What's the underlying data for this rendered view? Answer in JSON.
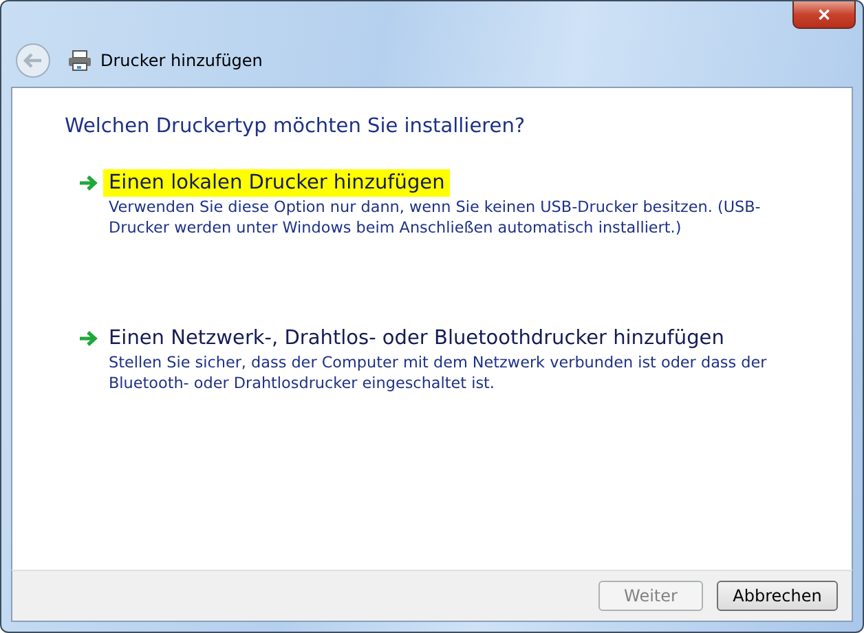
{
  "window": {
    "title": "Drucker hinzufügen",
    "close": "✕"
  },
  "heading": "Welchen Druckertyp möchten Sie installieren?",
  "options": [
    {
      "title": "Einen lokalen Drucker hinzufügen",
      "description": "Verwenden Sie diese Option nur dann, wenn Sie keinen USB-Drucker besitzen. (USB-Drucker werden unter Windows beim Anschließen automatisch installiert.)",
      "highlighted": true
    },
    {
      "title": "Einen Netzwerk-, Drahtlos- oder Bluetoothdrucker hinzufügen",
      "description": "Stellen Sie sicher, dass der Computer mit dem Netzwerk verbunden ist oder dass der Bluetooth- oder Drahtlosdrucker eingeschaltet ist.",
      "highlighted": false
    }
  ],
  "buttons": [
    {
      "label": "Weiter",
      "disabled": true
    },
    {
      "label": "Abbrechen",
      "disabled": false
    }
  ]
}
